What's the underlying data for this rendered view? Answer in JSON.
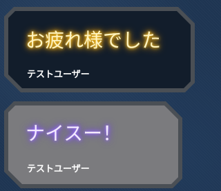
{
  "messages": [
    {
      "text": "お疲れ様でした",
      "sender": "テストユーザー",
      "glow_color": "#ffb300"
    },
    {
      "text": "ナイスー！",
      "sender": "テストユーザー",
      "glow_color": "#7f4dff"
    }
  ],
  "colors": {
    "background": "#1e3552",
    "bubble_border": "#4a4f55",
    "bubble_1_fill": "#121d2b",
    "bubble_2_fill": "#7b7b7e"
  }
}
